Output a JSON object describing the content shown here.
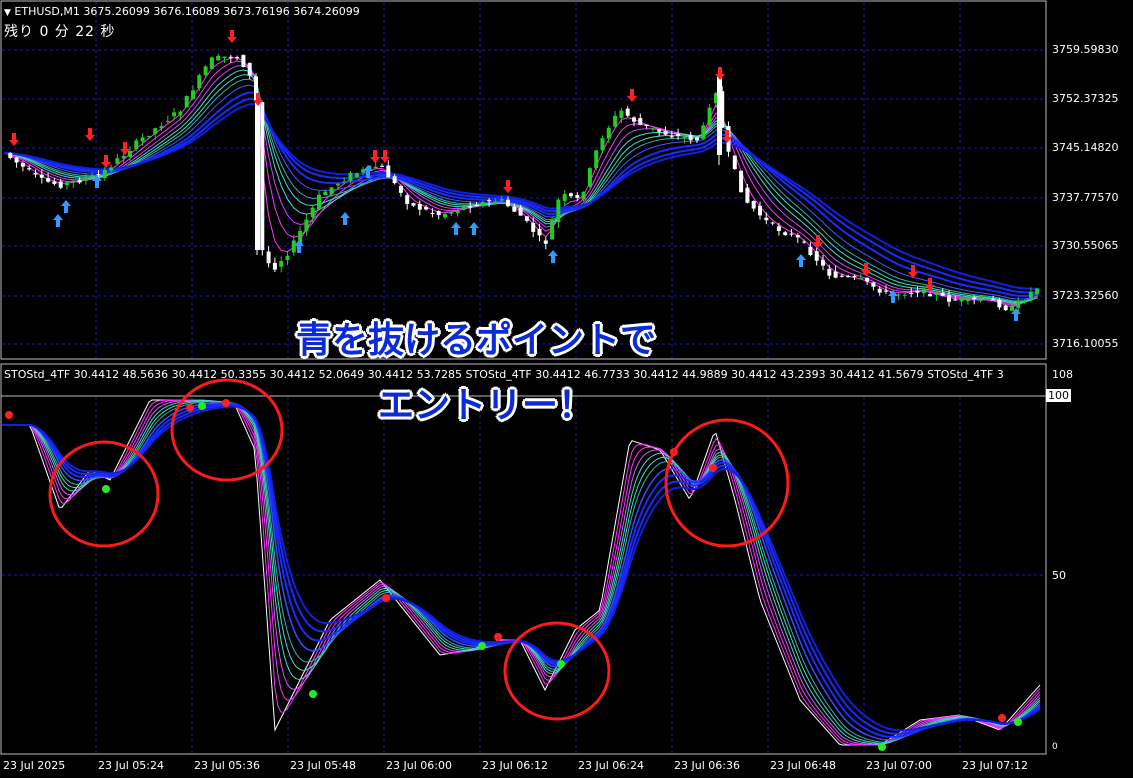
{
  "header": {
    "symbol_line": "ETHUSD,M1  3675.26099 3676.16089 3673.76196 3674.26099",
    "countdown": "残り 0 分 22 秒"
  },
  "price_axis": [
    "3759.59830",
    "3752.37325",
    "3745.14820",
    "3737.77570",
    "3730.55065",
    "3723.32560",
    "3716.10055"
  ],
  "indicator": {
    "header": "STOStd_4TF 30.4412 48.5636 30.4412 50.3355 30.4412 52.0649 30.4412 53.7285  STOStd_4TF 30.4412 46.7733 30.4412 44.9889 30.4412 43.2393 30.4412 41.5679  STOStd_4TF 3",
    "axis": {
      "top": "108",
      "hundred": "100",
      "fifty": "50",
      "zero": "0"
    }
  },
  "time_axis": [
    "23 Jul 2025",
    "23 Jul 05:24",
    "23 Jul 05:36",
    "23 Jul 05:48",
    "23 Jul 06:00",
    "23 Jul 06:12",
    "23 Jul 06:24",
    "23 Jul 06:36",
    "23 Jul 06:48",
    "23 Jul 07:00",
    "23 Jul 07:12"
  ],
  "annotation": {
    "line1": "青を抜けるポイントで",
    "line2": "エントリー！"
  },
  "colors": {
    "background": "#000000",
    "bull": "#22cc22",
    "bear": "#ffffff",
    "blue_band": "#1a2bff",
    "magenta_band": "#ff33ff",
    "teal_band": "#40e0c0",
    "up_arrow": "#3399ff",
    "down_arrow": "#ff2222",
    "circle": "#ff1a1a",
    "grid": "#1a1aa0"
  }
}
